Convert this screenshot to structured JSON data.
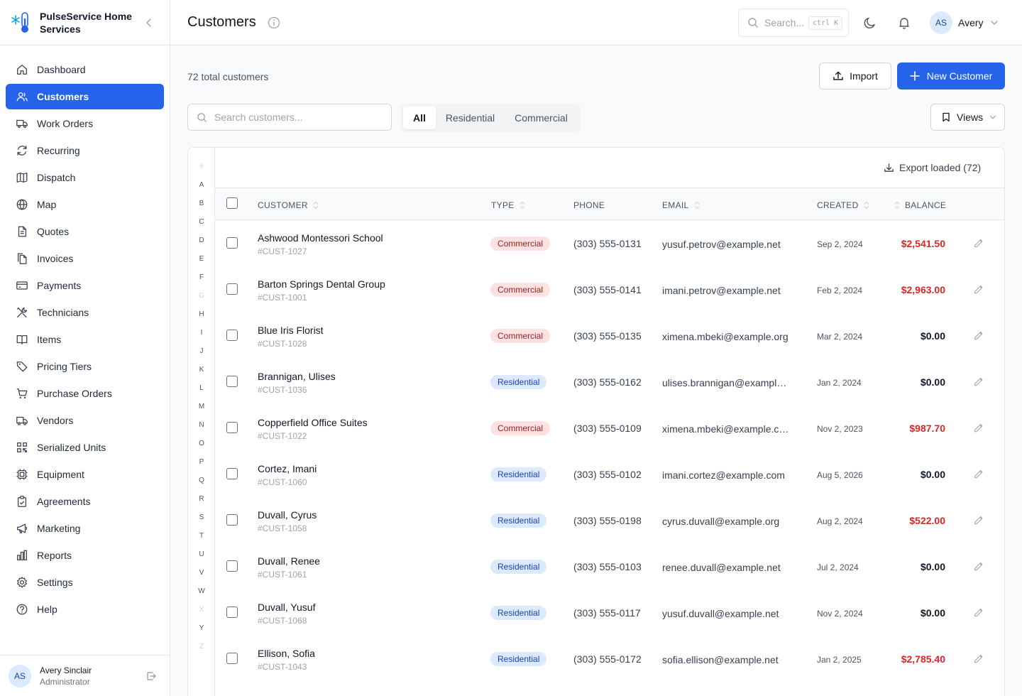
{
  "brand": {
    "name": "PulseService Home Services"
  },
  "sidebar": {
    "items": [
      {
        "label": "Dashboard",
        "icon": "home-icon"
      },
      {
        "label": "Customers",
        "icon": "users-icon",
        "active": true
      },
      {
        "label": "Work Orders",
        "icon": "truck-icon"
      },
      {
        "label": "Recurring",
        "icon": "refresh-icon"
      },
      {
        "label": "Dispatch",
        "icon": "map-fold-icon"
      },
      {
        "label": "Map",
        "icon": "globe-icon"
      },
      {
        "label": "Quotes",
        "icon": "document-icon"
      },
      {
        "label": "Invoices",
        "icon": "files-icon"
      },
      {
        "label": "Payments",
        "icon": "credit-card-icon"
      },
      {
        "label": "Technicians",
        "icon": "tools-icon"
      },
      {
        "label": "Items",
        "icon": "book-icon"
      },
      {
        "label": "Pricing Tiers",
        "icon": "tag-icon"
      },
      {
        "label": "Purchase Orders",
        "icon": "cart-icon"
      },
      {
        "label": "Vendors",
        "icon": "delivery-truck-icon"
      },
      {
        "label": "Serialized Units",
        "icon": "qr-icon"
      },
      {
        "label": "Equipment",
        "icon": "chip-icon"
      },
      {
        "label": "Agreements",
        "icon": "clipboard-icon"
      },
      {
        "label": "Marketing",
        "icon": "megaphone-icon"
      },
      {
        "label": "Reports",
        "icon": "bar-chart-icon"
      },
      {
        "label": "Settings",
        "icon": "gear-icon"
      },
      {
        "label": "Help",
        "icon": "help-icon"
      }
    ]
  },
  "footer_user": {
    "initials": "AS",
    "name": "Avery Sinclair",
    "role": "Administrator"
  },
  "header": {
    "title": "Customers",
    "search_placeholder": "Search...",
    "shortcut": "ctrl K",
    "user_initials": "AS",
    "user_name": "Avery"
  },
  "main": {
    "total": "72 total customers",
    "import_label": "Import",
    "new_label": "New Customer",
    "search_placeholder": "Search customers...",
    "filters": [
      "All",
      "Residential",
      "Commercial"
    ],
    "views_label": "Views",
    "export_label": "Export loaded (72)"
  },
  "alphabet": [
    "#",
    "A",
    "B",
    "C",
    "D",
    "E",
    "F",
    "G",
    "H",
    "I",
    "J",
    "K",
    "L",
    "M",
    "N",
    "O",
    "P",
    "Q",
    "R",
    "S",
    "T",
    "U",
    "V",
    "W",
    "X",
    "Y",
    "Z"
  ],
  "alphabet_dim": [
    "#",
    "G",
    "X",
    "Z"
  ],
  "table": {
    "columns": [
      "CUSTOMER",
      "TYPE",
      "PHONE",
      "EMAIL",
      "CREATED",
      "BALANCE"
    ],
    "rows": [
      {
        "name": "Ashwood Montessori School",
        "id": "#CUST-1027",
        "type": "Commercial",
        "phone": "(303) 555-0131",
        "email": "yusuf.petrov@example.net",
        "created": "Sep 2, 2024",
        "balance": "$2,541.50",
        "due": true
      },
      {
        "name": "Barton Springs Dental Group",
        "id": "#CUST-1001",
        "type": "Commercial",
        "phone": "(303) 555-0141",
        "email": "imani.petrov@example.net",
        "created": "Feb 2, 2024",
        "balance": "$2,963.00",
        "due": true
      },
      {
        "name": "Blue Iris Florist",
        "id": "#CUST-1028",
        "type": "Commercial",
        "phone": "(303) 555-0135",
        "email": "ximena.mbeki@example.org",
        "created": "Mar 2, 2024",
        "balance": "$0.00",
        "due": false
      },
      {
        "name": "Brannigan, Ulises",
        "id": "#CUST-1036",
        "type": "Residential",
        "phone": "(303) 555-0162",
        "email": "ulises.brannigan@example.com",
        "created": "Jan 2, 2024",
        "balance": "$0.00",
        "due": false
      },
      {
        "name": "Copperfield Office Suites",
        "id": "#CUST-1022",
        "type": "Commercial",
        "phone": "(303) 555-0109",
        "email": "ximena.mbeki@example.com",
        "created": "Nov 2, 2023",
        "balance": "$987.70",
        "due": true
      },
      {
        "name": "Cortez, Imani",
        "id": "#CUST-1060",
        "type": "Residential",
        "phone": "(303) 555-0102",
        "email": "imani.cortez@example.com",
        "created": "Aug 5, 2026",
        "balance": "$0.00",
        "due": false
      },
      {
        "name": "Duvall, Cyrus",
        "id": "#CUST-1058",
        "type": "Residential",
        "phone": "(303) 555-0198",
        "email": "cyrus.duvall@example.org",
        "created": "Aug 2, 2024",
        "balance": "$522.00",
        "due": true
      },
      {
        "name": "Duvall, Renee",
        "id": "#CUST-1061",
        "type": "Residential",
        "phone": "(303) 555-0103",
        "email": "renee.duvall@example.net",
        "created": "Jul 2, 2024",
        "balance": "$0.00",
        "due": false
      },
      {
        "name": "Duvall, Yusuf",
        "id": "#CUST-1068",
        "type": "Residential",
        "phone": "(303) 555-0117",
        "email": "yusuf.duvall@example.net",
        "created": "Nov 2, 2024",
        "balance": "$0.00",
        "due": false
      },
      {
        "name": "Ellison, Sofia",
        "id": "#CUST-1043",
        "type": "Residential",
        "phone": "(303) 555-0172",
        "email": "sofia.ellison@example.net",
        "created": "Jan 2, 2025",
        "balance": "$2,785.40",
        "due": true
      }
    ]
  }
}
